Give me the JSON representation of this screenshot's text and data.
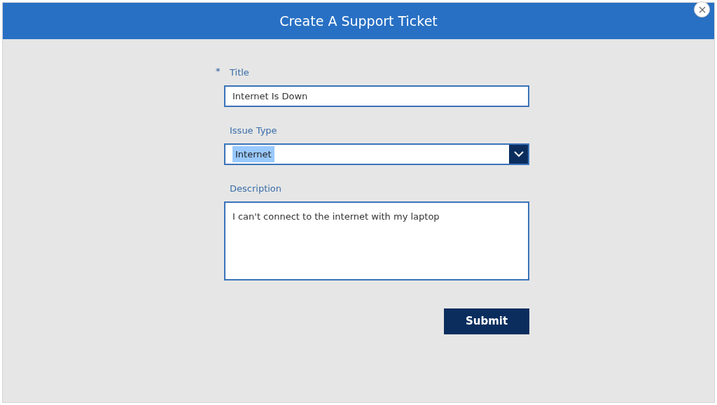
{
  "window": {
    "title": "Create A Support Ticket",
    "close_icon": true
  },
  "fields": [
    {
      "kind": "text",
      "label": "Title",
      "required": true,
      "value": "Internet Is Down"
    },
    {
      "kind": "dropdown",
      "label": "Issue Type",
      "required": false,
      "value": "Internet",
      "highlighted": true
    },
    {
      "kind": "multiline",
      "label": "Description",
      "required": false,
      "value": "I can't connect to the internet with my laptop"
    }
  ],
  "required_mark": "*",
  "buttons": [
    {
      "label": "Submit"
    }
  ]
}
